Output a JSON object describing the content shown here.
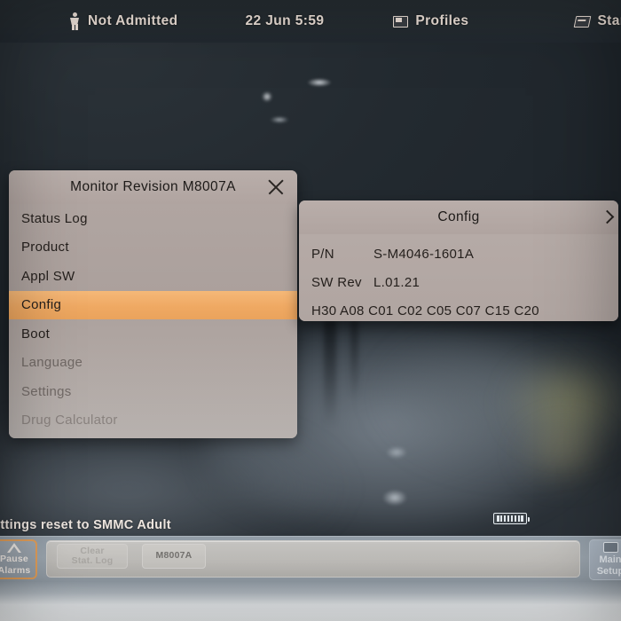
{
  "topbar": {
    "patient_icon": "patient-icon",
    "patient_status": "Not  Admitted",
    "datetime": "22  Jun   5:59",
    "profiles_icon": "card-icon",
    "profiles_label": "Profiles",
    "start_icon": "card-slanted-icon",
    "start_label": "Star"
  },
  "menu_dialog": {
    "title": "Monitor  Revision  M8007A",
    "close_icon": "close-icon",
    "items": [
      {
        "label": "Status  Log",
        "state": "normal"
      },
      {
        "label": "Product",
        "state": "normal"
      },
      {
        "label": "Appl  SW",
        "state": "normal"
      },
      {
        "label": "Config",
        "state": "selected"
      },
      {
        "label": "Boot",
        "state": "normal"
      },
      {
        "label": "Language",
        "state": "dim"
      },
      {
        "label": "Settings",
        "state": "dim"
      },
      {
        "label": "Drug  Calculator",
        "state": "dimmer"
      }
    ]
  },
  "config_dialog": {
    "title": "Config",
    "expand_icon": "chevron-right-icon",
    "rows": [
      {
        "label": "P/N",
        "value": "S-M4046-1601A"
      },
      {
        "label": "SW  Rev",
        "value": "L.01.21"
      }
    ],
    "flags": "H30  A08  C01  C02  C05  C07  C15  C20"
  },
  "status": {
    "message": "ettings  reset  to  SMMC  Adult",
    "battery_icon": "battery-icon"
  },
  "bottom_bar": {
    "alarm_key": {
      "icon": "alarm-triangle-icon",
      "line1": "Pause",
      "line2": "Alarms"
    },
    "softkeys": [
      {
        "line1": "Clear",
        "line2": "Stat. Log",
        "state": "disabled"
      },
      {
        "line1": "M8007A",
        "line2": "",
        "state": "normal"
      }
    ],
    "main_setup": {
      "icon": "monitor-icon",
      "line1": "Main",
      "line2": "Setup"
    }
  },
  "colors": {
    "accent_highlight": "#efa963",
    "dialog_bg": "#b0a5a1",
    "screen_bg": "#232a30",
    "topbar_text": "#efe3da",
    "bottom_bar": "#98a2ab",
    "alarm_border": "#e49a4e"
  }
}
